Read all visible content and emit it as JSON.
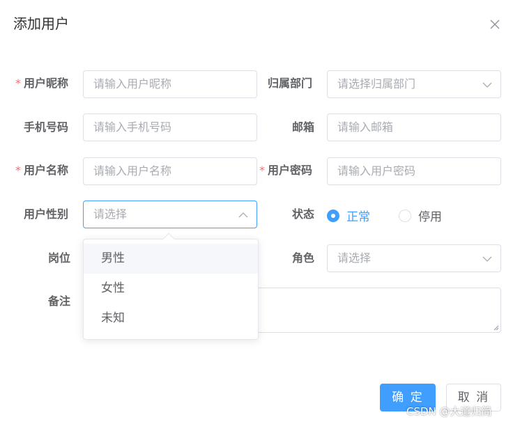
{
  "dialog": {
    "title": "添加用户"
  },
  "form": {
    "nickname": {
      "label": "用户昵称",
      "required": "*",
      "placeholder": "请输入用户昵称"
    },
    "dept": {
      "label": "归属部门",
      "placeholder": "请选择归属部门"
    },
    "phone": {
      "label": "手机号码",
      "placeholder": "请输入手机号码"
    },
    "email": {
      "label": "邮箱",
      "placeholder": "请输入邮箱"
    },
    "username": {
      "label": "用户名称",
      "required": "*",
      "placeholder": "请输入用户名称"
    },
    "password": {
      "label": "用户密码",
      "required": "*",
      "placeholder": "请输入用户密码"
    },
    "gender": {
      "label": "用户性别",
      "placeholder": "请选择",
      "options": [
        "男性",
        "女性",
        "未知"
      ]
    },
    "status": {
      "label": "状态",
      "options": [
        "正常",
        "停用"
      ],
      "selected": "正常"
    },
    "post": {
      "label": "岗位"
    },
    "role": {
      "label": "角色",
      "placeholder": "请选择"
    },
    "remark": {
      "label": "备注"
    }
  },
  "footer": {
    "confirm": "确 定",
    "cancel": "取 消"
  },
  "watermark": "CSDN @大道归简",
  "colors": {
    "primary": "#409eff",
    "required": "#f56c6c",
    "border": "#dcdfe6"
  }
}
